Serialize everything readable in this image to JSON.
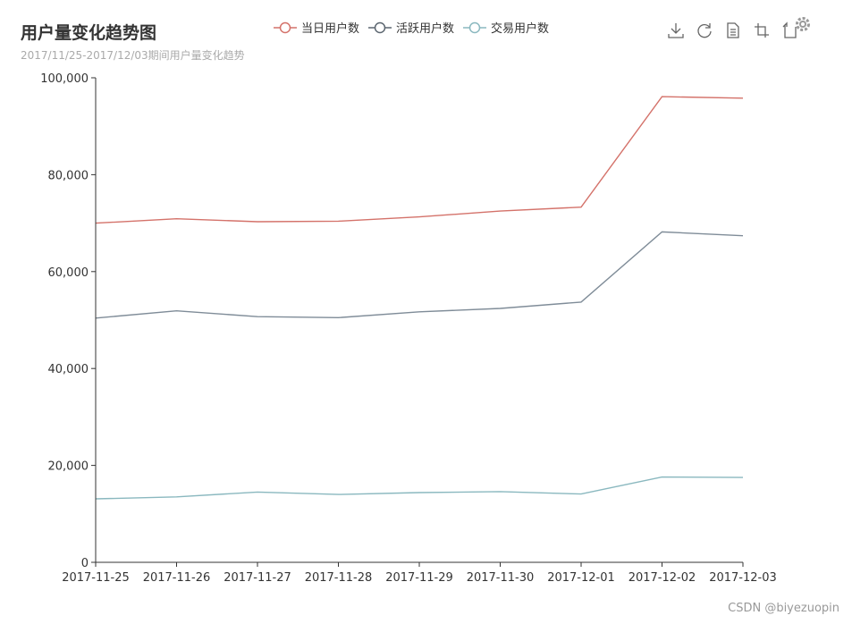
{
  "chart_data": {
    "type": "line",
    "title": "用户量变化趋势图",
    "subtitle": "2017/11/25-2017/12/03期间用户量变化趋势",
    "categories": [
      "2017-11-25",
      "2017-11-26",
      "2017-11-27",
      "2017-11-28",
      "2017-11-29",
      "2017-11-30",
      "2017-12-01",
      "2017-12-02",
      "2017-12-03"
    ],
    "ylim": [
      0,
      100000
    ],
    "yticks": [
      "0",
      "20,000",
      "40,000",
      "60,000",
      "80,000",
      "100,000"
    ],
    "legend_position": "top-center",
    "series": [
      {
        "name": "当日用户数",
        "color": "#d4726a",
        "values": [
          70000,
          70900,
          70300,
          70400,
          71300,
          72500,
          73300,
          96100,
          95800
        ]
      },
      {
        "name": "活跃用户数",
        "color": "#7f8c98",
        "values": [
          50400,
          51900,
          50700,
          50500,
          51700,
          52400,
          53700,
          68200,
          67400
        ]
      },
      {
        "name": "交易用户数",
        "color": "#8ab8bf",
        "values": [
          13100,
          13500,
          14500,
          14000,
          14400,
          14600,
          14100,
          17600,
          17500
        ]
      }
    ]
  },
  "watermark": "CSDN @biyezuopin",
  "toolbox": {
    "icons": [
      "download-icon",
      "refresh-icon",
      "data-view-icon",
      "zoom-icon",
      "restore-icon",
      "gear-icon"
    ]
  }
}
